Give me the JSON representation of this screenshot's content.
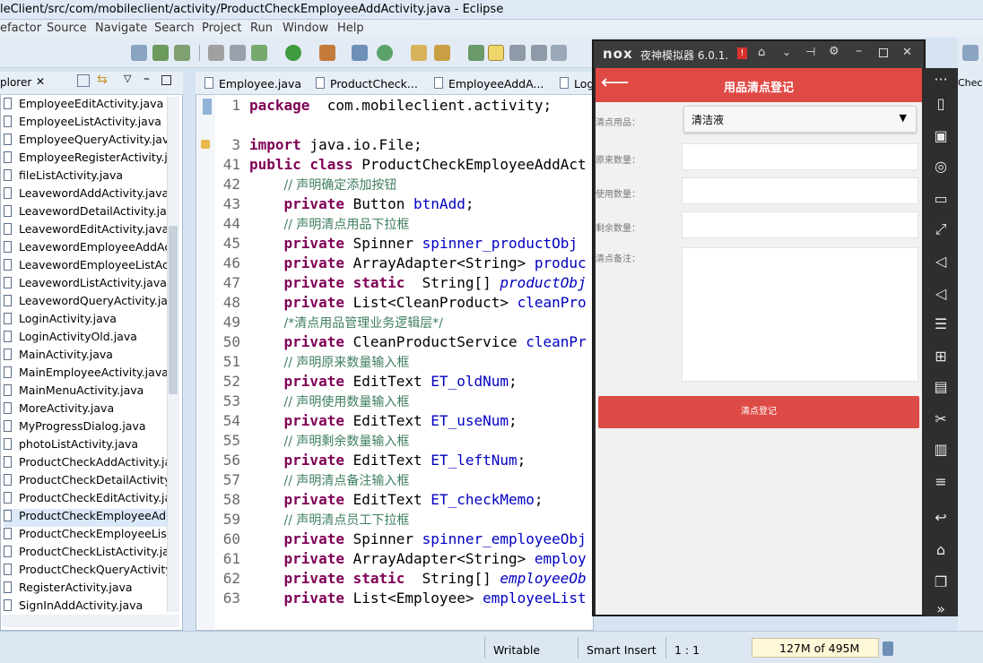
{
  "window": {
    "title": "leClient/src/com/mobileclient/activity/ProductCheckEmployeeAddActivity.java - Eclipse"
  },
  "menu": [
    "efactor",
    "Source",
    "Navigate",
    "Search",
    "Project",
    "Run",
    "Window",
    "Help"
  ],
  "explorer": {
    "tab_label": "plorer",
    "files": [
      "EmployeeEditActivity.java",
      "EmployeeListActivity.java",
      "EmployeeQueryActivity.java",
      "EmployeeRegisterActivity.ja",
      "fileListActivity.java",
      "LeavewordAddActivity.java",
      "LeavewordDetailActivity.java",
      "LeavewordEditActivity.java",
      "LeavewordEmployeeAddAc",
      "LeavewordEmployeeListAct",
      "LeavewordListActivity.java",
      "LeavewordQueryActivity.jav",
      "LoginActivity.java",
      "LoginActivityOld.java",
      "MainActivity.java",
      "MainEmployeeActivity.java",
      "MainMenuActivity.java",
      "MoreActivity.java",
      "MyProgressDialog.java",
      "photoListActivity.java",
      "ProductCheckAddActivity.jav",
      "ProductCheckDetailActivity.j",
      "ProductCheckEditActivity.jav",
      "ProductCheckEmployeeAdd",
      "ProductCheckEmployeeListA",
      "ProductCheckListActivity.jav",
      "ProductCheckQueryActivity.",
      "RegisterActivity.java",
      "SignInAddActivity.java"
    ],
    "selected_index": 23
  },
  "editor": {
    "tabs": [
      "Employee.java",
      "ProductCheck...",
      "EmployeeAddA...",
      "Log"
    ],
    "right_tab": "Checl",
    "lines": [
      {
        "n": "1",
        "parts": [
          [
            "kw",
            "package"
          ],
          [
            "",
            "  com.mobileclient.activity;"
          ]
        ]
      },
      {
        "n": "",
        "parts": []
      },
      {
        "n": "3",
        "parts": [
          [
            "kw",
            "import"
          ],
          [
            "",
            " java.io.File;"
          ]
        ]
      },
      {
        "n": "41",
        "parts": [
          [
            "kw",
            "public class"
          ],
          [
            "",
            " ProductCheckEmployeeAddAct"
          ]
        ]
      },
      {
        "n": "42",
        "parts": [
          [
            "",
            "    "
          ],
          [
            "cm",
            "// 声明确定添加按钮"
          ]
        ]
      },
      {
        "n": "43",
        "parts": [
          [
            "",
            "    "
          ],
          [
            "kw",
            "private"
          ],
          [
            "",
            " Button "
          ],
          [
            "fld",
            "btnAdd"
          ],
          [
            "",
            ";"
          ]
        ]
      },
      {
        "n": "44",
        "parts": [
          [
            "",
            "    "
          ],
          [
            "cm",
            "// 声明清点用品下拉框"
          ]
        ]
      },
      {
        "n": "45",
        "parts": [
          [
            "",
            "    "
          ],
          [
            "kw",
            "private"
          ],
          [
            "",
            " Spinner "
          ],
          [
            "fld",
            "spinner_productObj"
          ]
        ]
      },
      {
        "n": "46",
        "parts": [
          [
            "",
            "    "
          ],
          [
            "kw",
            "private"
          ],
          [
            "",
            " ArrayAdapter<String> "
          ],
          [
            "fld",
            "produc"
          ]
        ]
      },
      {
        "n": "47",
        "parts": [
          [
            "",
            "    "
          ],
          [
            "kw",
            "private static"
          ],
          [
            "",
            "  String[] "
          ],
          [
            "it",
            "productObj"
          ]
        ]
      },
      {
        "n": "48",
        "parts": [
          [
            "",
            "    "
          ],
          [
            "kw",
            "private"
          ],
          [
            "",
            " List<CleanProduct> "
          ],
          [
            "fld",
            "cleanPro"
          ]
        ]
      },
      {
        "n": "49",
        "parts": [
          [
            "",
            "    "
          ],
          [
            "cm",
            "/*清点用品管理业务逻辑层*/"
          ]
        ]
      },
      {
        "n": "50",
        "parts": [
          [
            "",
            "    "
          ],
          [
            "kw",
            "private"
          ],
          [
            "",
            " CleanProductService "
          ],
          [
            "fld",
            "cleanPr"
          ]
        ]
      },
      {
        "n": "51",
        "parts": [
          [
            "",
            "    "
          ],
          [
            "cm",
            "// 声明原来数量输入框"
          ]
        ]
      },
      {
        "n": "52",
        "parts": [
          [
            "",
            "    "
          ],
          [
            "kw",
            "private"
          ],
          [
            "",
            " EditText "
          ],
          [
            "fld",
            "ET_oldNum"
          ],
          [
            "",
            ";"
          ]
        ]
      },
      {
        "n": "53",
        "parts": [
          [
            "",
            "    "
          ],
          [
            "cm",
            "// 声明使用数量输入框"
          ]
        ]
      },
      {
        "n": "54",
        "parts": [
          [
            "",
            "    "
          ],
          [
            "kw",
            "private"
          ],
          [
            "",
            " EditText "
          ],
          [
            "fld",
            "ET_useNum"
          ],
          [
            "",
            ";"
          ]
        ]
      },
      {
        "n": "55",
        "parts": [
          [
            "",
            "    "
          ],
          [
            "cm",
            "// 声明剩余数量输入框"
          ]
        ]
      },
      {
        "n": "56",
        "parts": [
          [
            "",
            "    "
          ],
          [
            "kw",
            "private"
          ],
          [
            "",
            " EditText "
          ],
          [
            "fld",
            "ET_leftNum"
          ],
          [
            "",
            ";"
          ]
        ]
      },
      {
        "n": "57",
        "parts": [
          [
            "",
            "    "
          ],
          [
            "cm",
            "// 声明清点备注输入框"
          ]
        ]
      },
      {
        "n": "58",
        "parts": [
          [
            "",
            "    "
          ],
          [
            "kw",
            "private"
          ],
          [
            "",
            " EditText "
          ],
          [
            "fld",
            "ET_checkMemo"
          ],
          [
            "",
            ";"
          ]
        ]
      },
      {
        "n": "59",
        "parts": [
          [
            "",
            "    "
          ],
          [
            "cm",
            "// 声明清点员工下拉框"
          ]
        ]
      },
      {
        "n": "60",
        "parts": [
          [
            "",
            "    "
          ],
          [
            "kw",
            "private"
          ],
          [
            "",
            " Spinner "
          ],
          [
            "fld",
            "spinner_employeeObj"
          ]
        ]
      },
      {
        "n": "61",
        "parts": [
          [
            "",
            "    "
          ],
          [
            "kw",
            "private"
          ],
          [
            "",
            " ArrayAdapter<String> "
          ],
          [
            "fld",
            "employ"
          ]
        ]
      },
      {
        "n": "62",
        "parts": [
          [
            "",
            "    "
          ],
          [
            "kw",
            "private static"
          ],
          [
            "",
            "  String[] "
          ],
          [
            "it",
            "employeeOb"
          ]
        ]
      },
      {
        "n": "63",
        "parts": [
          [
            "",
            "    "
          ],
          [
            "kw",
            "private"
          ],
          [
            "",
            " List<Employee> "
          ],
          [
            "fld",
            "employeeList"
          ]
        ]
      }
    ]
  },
  "status": {
    "writable": "Writable",
    "insert_mode": "Smart Insert",
    "position": "1 : 1",
    "heap": "127M of 495M"
  },
  "emulator": {
    "brand": "nox",
    "name": "夜神模拟器 6.0.1.",
    "app": {
      "title": "用品清点登记",
      "fields": [
        {
          "label": "清点用品：",
          "value": "清洁液"
        },
        {
          "label": "原来数量：",
          "value": ""
        },
        {
          "label": "使用数量：",
          "value": ""
        },
        {
          "label": "剩余数量：",
          "value": ""
        },
        {
          "label": "清点备注：",
          "value": ""
        }
      ],
      "submit_label": "清点登记"
    }
  }
}
